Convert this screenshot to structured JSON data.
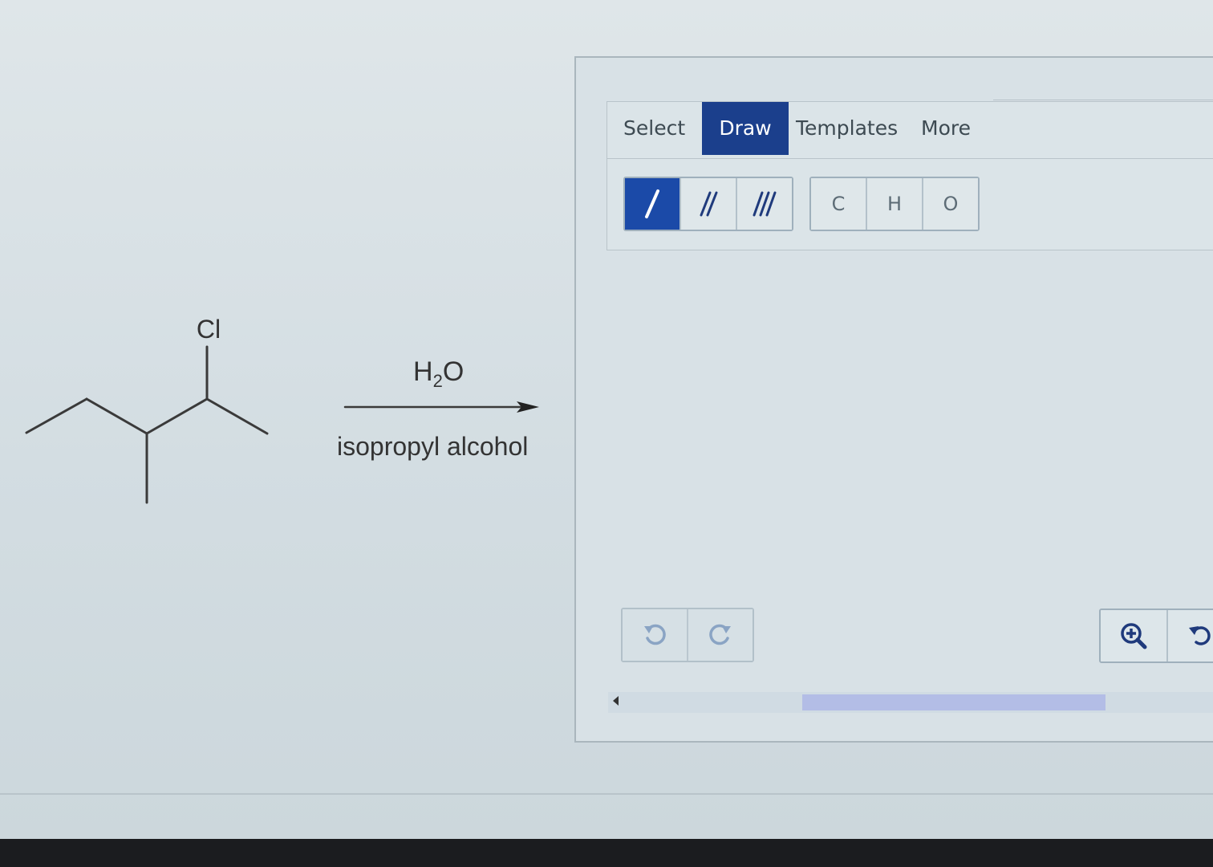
{
  "reaction": {
    "substituent_label": "Cl",
    "reagent_above": {
      "prefix": "H",
      "subscript": "2",
      "suffix": "O"
    },
    "reagent_below": "isopropyl alcohol"
  },
  "sketcher": {
    "tabs": [
      {
        "label": "Select",
        "active": false
      },
      {
        "label": "Draw",
        "active": true
      },
      {
        "label": "Templates",
        "active": false
      },
      {
        "label": "More",
        "active": false
      }
    ],
    "bond_tools": [
      {
        "icon": "single-bond-icon",
        "active": true
      },
      {
        "icon": "double-bond-icon",
        "active": false
      },
      {
        "icon": "triple-bond-icon",
        "active": false
      }
    ],
    "atom_tools": [
      "C",
      "H",
      "O"
    ],
    "history": {
      "undo_icon": "undo-icon",
      "redo_icon": "redo-icon"
    },
    "zoom": {
      "zoom_in_icon": "zoom-in-icon",
      "reset_icon": "reset-zoom-icon"
    },
    "colors": {
      "active_tab": "#1b3f8c",
      "active_tool": "#1b4aa8",
      "scroll_thumb": "#b3bde6"
    }
  }
}
